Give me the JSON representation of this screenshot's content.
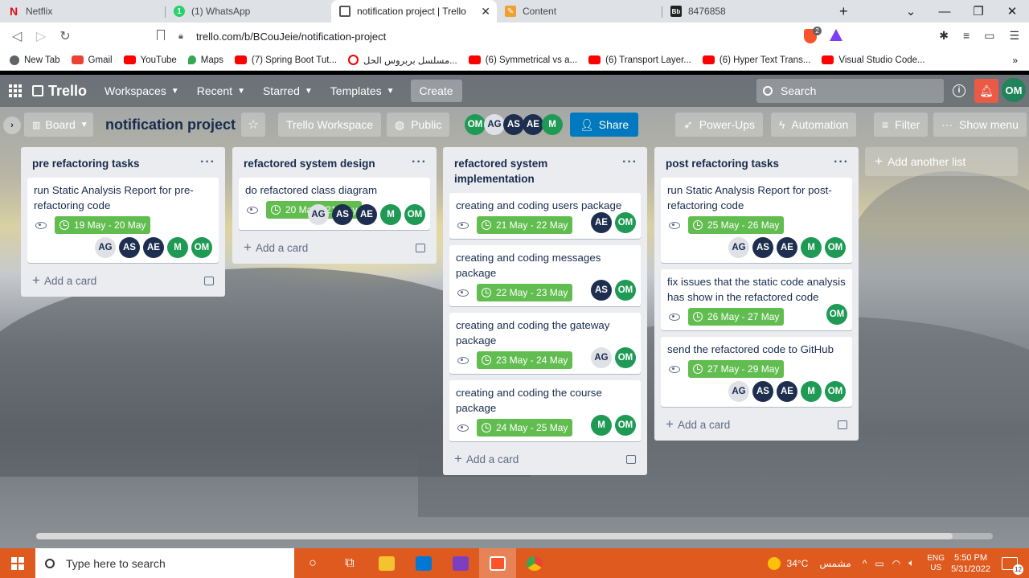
{
  "browser": {
    "tabs": [
      {
        "title": "Netflix",
        "icon": "netflix-icon",
        "color": "#e50914",
        "glyph": "N"
      },
      {
        "title": "(1) WhatsApp",
        "icon": "whatsapp-icon",
        "color": "#25d366",
        "glyph": "1"
      },
      {
        "title": "notification project | Trello",
        "icon": "trello-icon",
        "color": "#0079bf",
        "glyph": "▣"
      },
      {
        "title": "Content",
        "icon": "content-icon",
        "color": "#f0a030",
        "glyph": "✎"
      },
      {
        "title": "8476858",
        "icon": "bb-icon",
        "color": "#222",
        "glyph": "Bb"
      }
    ],
    "url": "trello.com/b/BCouJeie/notification-project",
    "extension_badge": "2",
    "bookmarks": [
      {
        "label": "New Tab",
        "color": "#5f6368"
      },
      {
        "label": "Gmail",
        "color": "#ea4335"
      },
      {
        "label": "YouTube",
        "color": "#ff0000"
      },
      {
        "label": "Maps",
        "color": "#34a853"
      },
      {
        "label": "(7) Spring Boot Tut...",
        "color": "#ff0000"
      },
      {
        "label": "مسلسل بربروس الحل...",
        "color": "#ff0000"
      },
      {
        "label": "(6) Symmetrical vs a...",
        "color": "#ff0000"
      },
      {
        "label": "(6) Transport Layer...",
        "color": "#ff0000"
      },
      {
        "label": "(6) Hyper Text Trans...",
        "color": "#ff0000"
      },
      {
        "label": "Visual Studio Code...",
        "color": "#ff0000"
      }
    ],
    "bookmarks_more": "»"
  },
  "trello": {
    "logo": "Trello",
    "nav": {
      "workspaces": "Workspaces",
      "recent": "Recent",
      "starred": "Starred",
      "templates": "Templates",
      "create": "Create",
      "search_placeholder": "Search",
      "user_initials": "OM"
    },
    "board": {
      "view_label": "Board",
      "title": "notification project",
      "workspace": "Trello Workspace",
      "visibility": "Public",
      "members": [
        "OM",
        "AG",
        "AS",
        "AE",
        "M"
      ],
      "share": "Share",
      "power_ups": "Power-Ups",
      "automation": "Automation",
      "filter": "Filter",
      "show_menu": "Show menu",
      "add_another_list": "Add another list"
    },
    "lists": [
      {
        "title": "pre refactoring tasks",
        "add_card": "Add a card",
        "cards": [
          {
            "title": "run Static Analysis Report for pre-refactoring code",
            "due": "19 May - 20 May",
            "members": [
              "AG",
              "AS",
              "AE",
              "M",
              "OM"
            ]
          }
        ]
      },
      {
        "title": "refactored system design",
        "add_card": "Add a card",
        "cards": [
          {
            "title": "do refactored class diagram",
            "due": "20 May - 21 May",
            "members": [
              "AG",
              "AS",
              "AE",
              "M",
              "OM"
            ]
          }
        ]
      },
      {
        "title": "refactored system implementation",
        "add_card": "Add a card",
        "cards": [
          {
            "title": "creating and coding users package",
            "due": "21 May - 22 May",
            "members": [
              "AE",
              "OM"
            ]
          },
          {
            "title": "creating and coding messages package",
            "due": "22 May - 23 May",
            "members": [
              "AS",
              "OM"
            ]
          },
          {
            "title": "creating and coding the gateway package",
            "due": "23 May - 24 May",
            "members": [
              "AG",
              "OM"
            ]
          },
          {
            "title": "creating and coding the course package",
            "due": "24 May - 25 May",
            "members": [
              "M",
              "OM"
            ]
          }
        ]
      },
      {
        "title": "post refactoring tasks",
        "add_card": "Add a card",
        "cards": [
          {
            "title": "run Static Analysis Report for post-refactoring code",
            "due": "25 May - 26 May",
            "members": [
              "AG",
              "AS",
              "AE",
              "M",
              "OM"
            ]
          },
          {
            "title": "fix issues that the static code analysis has show in the refactored code",
            "due": "26 May - 27 May",
            "members": [
              "OM"
            ]
          },
          {
            "title": "send the refactored code to GitHub",
            "due": "27 May - 29 May",
            "members": [
              "AG",
              "AS",
              "AE",
              "M",
              "OM"
            ]
          }
        ]
      }
    ]
  },
  "taskbar": {
    "search_placeholder": "Type here to search",
    "weather": "34°C",
    "weather_text": "مشمس",
    "lang_top": "ENG",
    "lang_bottom": "US",
    "time": "5:50 PM",
    "date": "5/31/2022",
    "notifications": "12"
  }
}
